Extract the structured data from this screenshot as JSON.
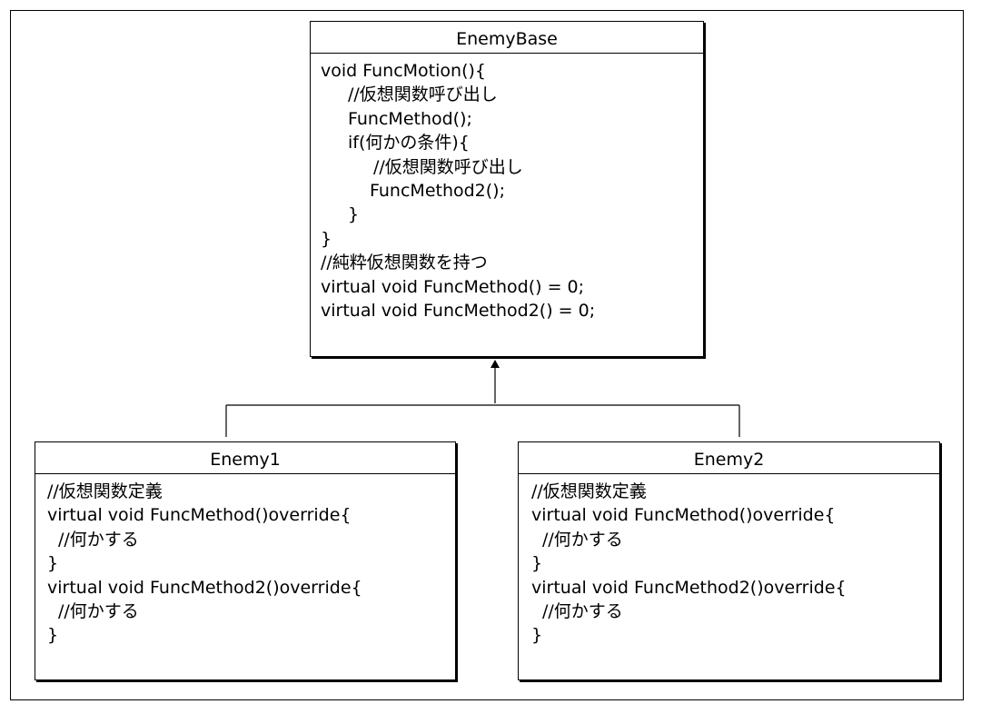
{
  "base": {
    "name": "EnemyBase",
    "lines": [
      "void FuncMotion(){",
      "//仮想関数呼び出し",
      "FuncMethod();",
      "if(何かの条件){",
      "//仮想関数呼び出し",
      "FuncMethod2();",
      "}",
      "}",
      "//純粋仮想関数を持つ",
      "virtual void FuncMethod() = 0;",
      "virtual void FuncMethod2() = 0;"
    ]
  },
  "enemy1": {
    "name": "Enemy1",
    "lines": [
      "//仮想関数定義",
      "virtual void FuncMethod()override{",
      "//何かする",
      "}",
      "virtual void FuncMethod2()override{",
      "//何かする",
      "}"
    ]
  },
  "enemy2": {
    "name": "Enemy2",
    "lines": [
      "//仮想関数定義",
      "virtual void FuncMethod()override{",
      "//何かする",
      "}",
      "virtual void FuncMethod2()override{",
      "//何かする",
      "}"
    ]
  }
}
